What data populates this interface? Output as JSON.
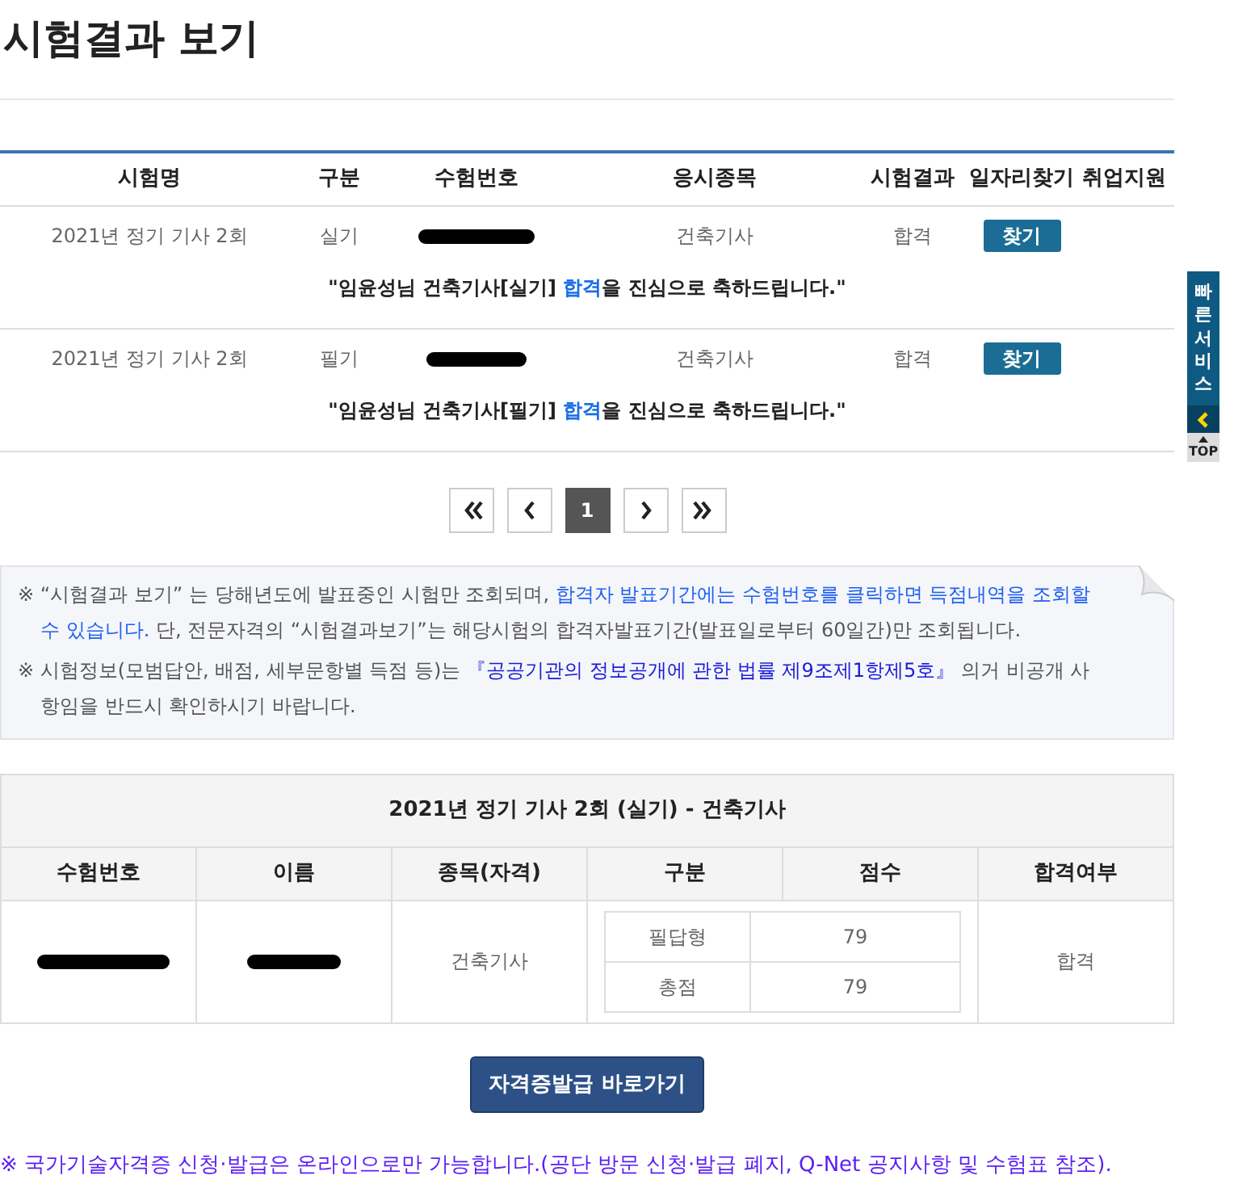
{
  "title": "시험결과 보기",
  "results_table": {
    "columns": [
      "시험명",
      "구분",
      "수험번호",
      "응시종목",
      "시험결과",
      "일자리찾기",
      "취업지원"
    ],
    "rows": [
      {
        "exam": "2021년 정기 기사 2회",
        "type": "실기",
        "number_redacted": true,
        "subject": "건축기사",
        "result": "합격",
        "job_button": "찾기",
        "message": [
          {
            "kind": "plain",
            "text": "\"임윤성님 건축기사[실기] "
          },
          {
            "kind": "highlight",
            "text": "합격"
          },
          {
            "kind": "plain",
            "text": "을 진심으로 축하드립니다.\""
          }
        ]
      },
      {
        "exam": "2021년 정기 기사 2회",
        "type": "필기",
        "number_redacted": true,
        "subject": "건축기사",
        "result": "합격",
        "job_button": "찾기",
        "message": [
          {
            "kind": "plain",
            "text": "\"임윤성님 건축기사[필기] "
          },
          {
            "kind": "highlight",
            "text": "합격"
          },
          {
            "kind": "plain",
            "text": "을 진심으로 축하드립니다.\""
          }
        ]
      }
    ]
  },
  "pagination": [
    {
      "kind": "first",
      "selected": false
    },
    {
      "kind": "prev",
      "selected": false
    },
    {
      "kind": "page",
      "label": "1",
      "selected": true
    },
    {
      "kind": "next",
      "selected": false
    },
    {
      "kind": "last",
      "selected": false
    }
  ],
  "notices": [
    {
      "mark": "※",
      "segments": [
        {
          "kind": "plain",
          "text": "“시험결과 보기” 는 당해년도에 발표중인 시험만 조회되며, "
        },
        {
          "kind": "link",
          "text": "합격자 발표기간에는 수험번호를 클릭하면 득점내역을 조회할 수 있습니다."
        },
        {
          "kind": "plain",
          "text": " 단, 전문자격의 “시험결과보기”는 해당시험의 합격자발표기간(발표일로부터 60일간)만 조회됩니다."
        }
      ]
    },
    {
      "mark": "※",
      "segments": [
        {
          "kind": "plain",
          "text": "시험정보(모범답안, 배점, 세부문항별 득점 등)는 "
        },
        {
          "kind": "law",
          "text": "『공공기관의 정보공개에 관한 법률 제9조제1항제5호』"
        },
        {
          "kind": "plain",
          "text": " 의거 비공개 사항임을 반드시 확인하시기 바랍니다."
        }
      ]
    }
  ],
  "score_table": {
    "title": "2021년 정기 기사 2회 (실기) - 건축기사",
    "columns": [
      "수험번호",
      "이름",
      "종목(자격)",
      "구분",
      "점수",
      "합격여부"
    ],
    "row": {
      "number_redacted": true,
      "name_redacted": true,
      "subject": "건축기사",
      "scores": [
        {
          "label": "필답형",
          "value": "79"
        },
        {
          "label": "총점",
          "value": "79"
        }
      ],
      "result": "합격"
    }
  },
  "issue_button": "자격증발급 바로가기",
  "footer_note": "※ 국가기술자격증 신청·발급은 온라인으로만 가능합니다.(공단 방문 신청·발급 폐지, Q-Net 공지사항 및 수험표 참조).",
  "quick_bar": {
    "label": "빠른서비스",
    "top": "TOP"
  }
}
